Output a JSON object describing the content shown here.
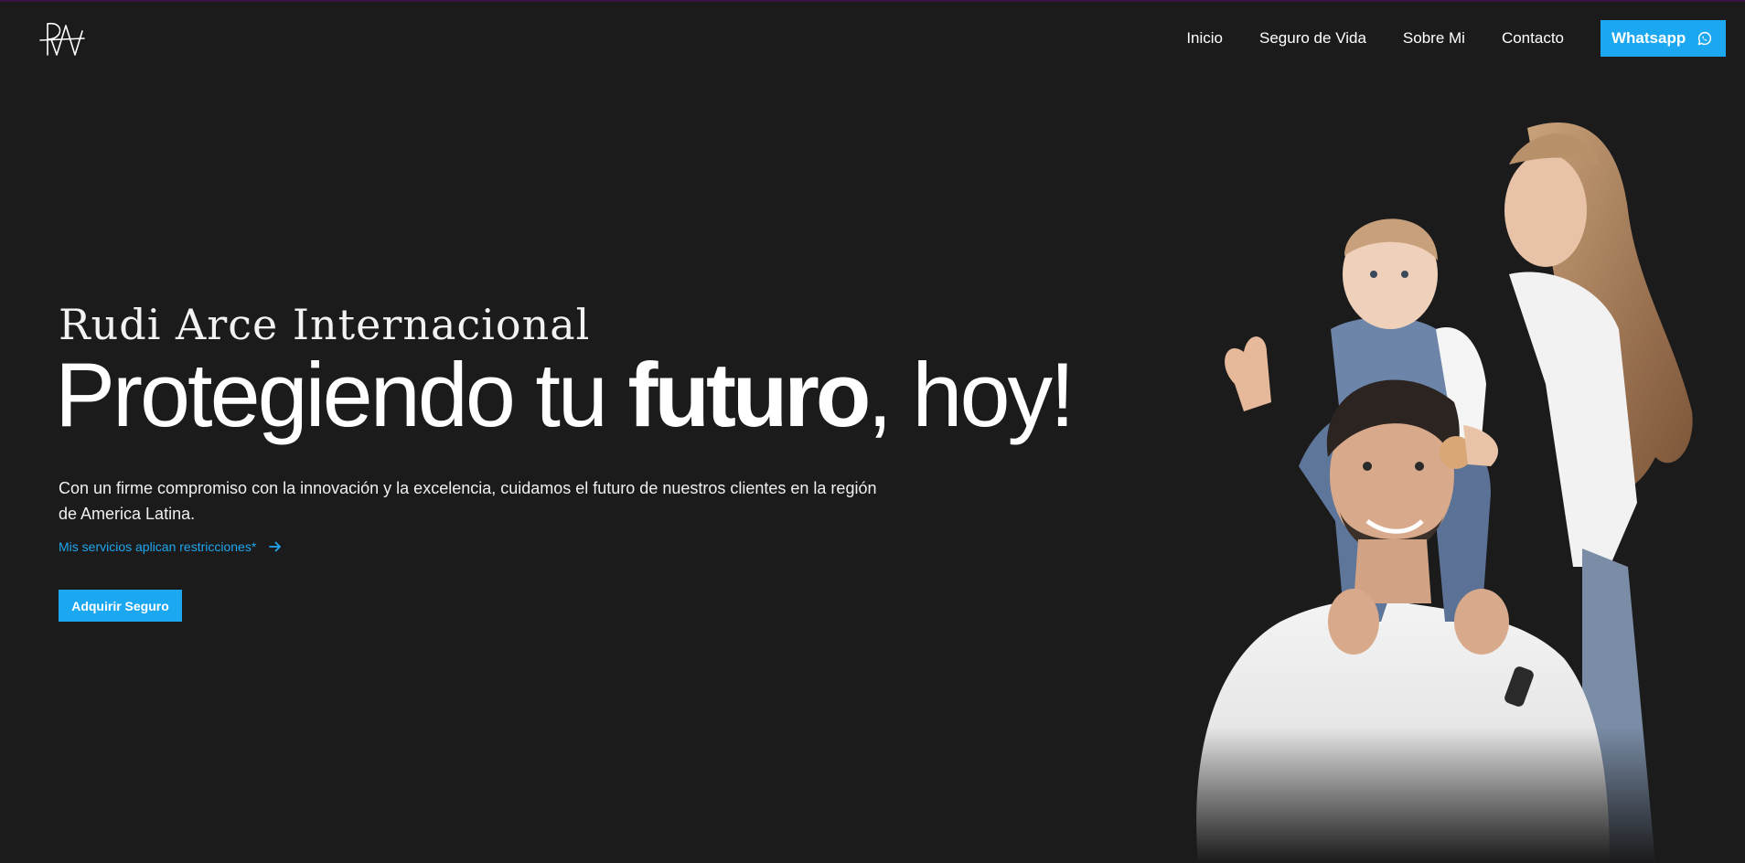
{
  "header": {
    "logo_text": "RA",
    "nav": [
      "Inicio",
      "Seguro de Vida",
      "Sobre Mi",
      "Contacto"
    ],
    "whatsapp_label": "Whatsapp",
    "whatsapp_icon": "whatsapp-icon"
  },
  "hero": {
    "brand": "Rudi Arce Internacional",
    "headline_pre": "Protegiendo tu ",
    "headline_bold": "futuro",
    "headline_post": ", hoy!",
    "description": "Con un firme compromiso con la innovación y la excelencia, cuidamos el futuro de nuestros clientes en la región de America Latina.",
    "note": "Mis servicios aplican restricciones*",
    "note_icon": "arrow-right-icon",
    "cta_label": "Adquirir Seguro"
  },
  "colors": {
    "background": "#1b1b1c",
    "accent": "#1ba8f0",
    "text": "#ffffff"
  }
}
